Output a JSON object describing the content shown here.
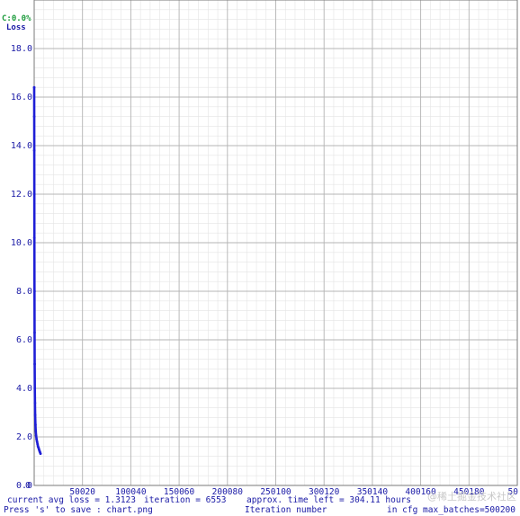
{
  "chart_data": {
    "type": "line",
    "map_label": "C:0.0%",
    "series": [
      {
        "name": "Loss",
        "x": [
          0,
          50,
          100,
          150,
          200,
          300,
          400,
          500,
          650,
          800,
          1000,
          1300,
          1600,
          2000,
          2500,
          3000,
          3500,
          4000,
          4500,
          5000,
          5500,
          6000,
          6553
        ],
        "y": [
          16.4,
          15.2,
          13.8,
          12.0,
          10.2,
          8.0,
          6.3,
          5.0,
          4.0,
          3.4,
          2.9,
          2.5,
          2.25,
          2.05,
          1.9,
          1.8,
          1.7,
          1.6,
          1.55,
          1.48,
          1.42,
          1.37,
          1.31
        ]
      }
    ],
    "xlabel": "Iteration number",
    "xticks": [
      "0",
      "50020",
      "100040",
      "150060",
      "200080",
      "250100",
      "300120",
      "350140",
      "400160",
      "450180",
      "50"
    ],
    "yticks": [
      "0.0",
      "2.0",
      "4.0",
      "6.0",
      "8.0",
      "10.0",
      "12.0",
      "14.0",
      "16.0",
      "18.0"
    ],
    "xlim": [
      0,
      500200
    ],
    "ylim": [
      0,
      20
    ],
    "grid": true,
    "legend": "top-left"
  },
  "status": {
    "avg_loss": "current avg loss = 1.3123",
    "iteration": "iteration = 6553",
    "time_left": "approx. time left = 304.11 hours"
  },
  "hint": {
    "save": "Press 's' to save : chart.png",
    "iter_label": "Iteration number",
    "max_batches": "in cfg max_batches=500200"
  },
  "watermark": "@稀土掘金技术社区",
  "colors": {
    "loss_line": "#1f1fd6",
    "map_label": "#1a9a3a",
    "axis_text": "#1a1aa6",
    "grid_major": "#b4b4b4",
    "grid_minor": "#e4e4e4"
  }
}
